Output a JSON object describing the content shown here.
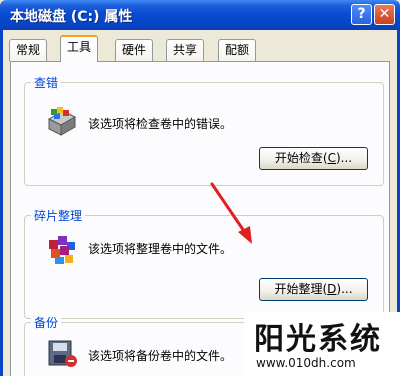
{
  "window": {
    "title": "本地磁盘 (C:) 属性",
    "help_button": "?",
    "close_button": "✕"
  },
  "tabs": [
    {
      "label": "常规",
      "active": false
    },
    {
      "label": "工具",
      "active": true
    },
    {
      "label": "硬件",
      "active": false
    },
    {
      "label": "共享",
      "active": false
    },
    {
      "label": "配额",
      "active": false
    }
  ],
  "groups": {
    "check": {
      "label": "查错",
      "description": "该选项将检查卷中的错误。",
      "button_prefix": "开始检查(",
      "button_key": "C",
      "button_suffix": ")..."
    },
    "defrag": {
      "label": "碎片整理",
      "description": "该选项将整理卷中的文件。",
      "button_prefix": "开始整理(",
      "button_key": "D",
      "button_suffix": ")..."
    },
    "backup": {
      "label": "备份",
      "description": "该选项将备份卷中的文件。"
    }
  },
  "watermark": {
    "brand": "阳光系统",
    "url": "www.010dh.com"
  },
  "colors": {
    "titlebar": "#0a4bd1",
    "group_label": "#0046d5",
    "arrow": "#e02020",
    "active_tab_accent": "#f3a21a"
  }
}
